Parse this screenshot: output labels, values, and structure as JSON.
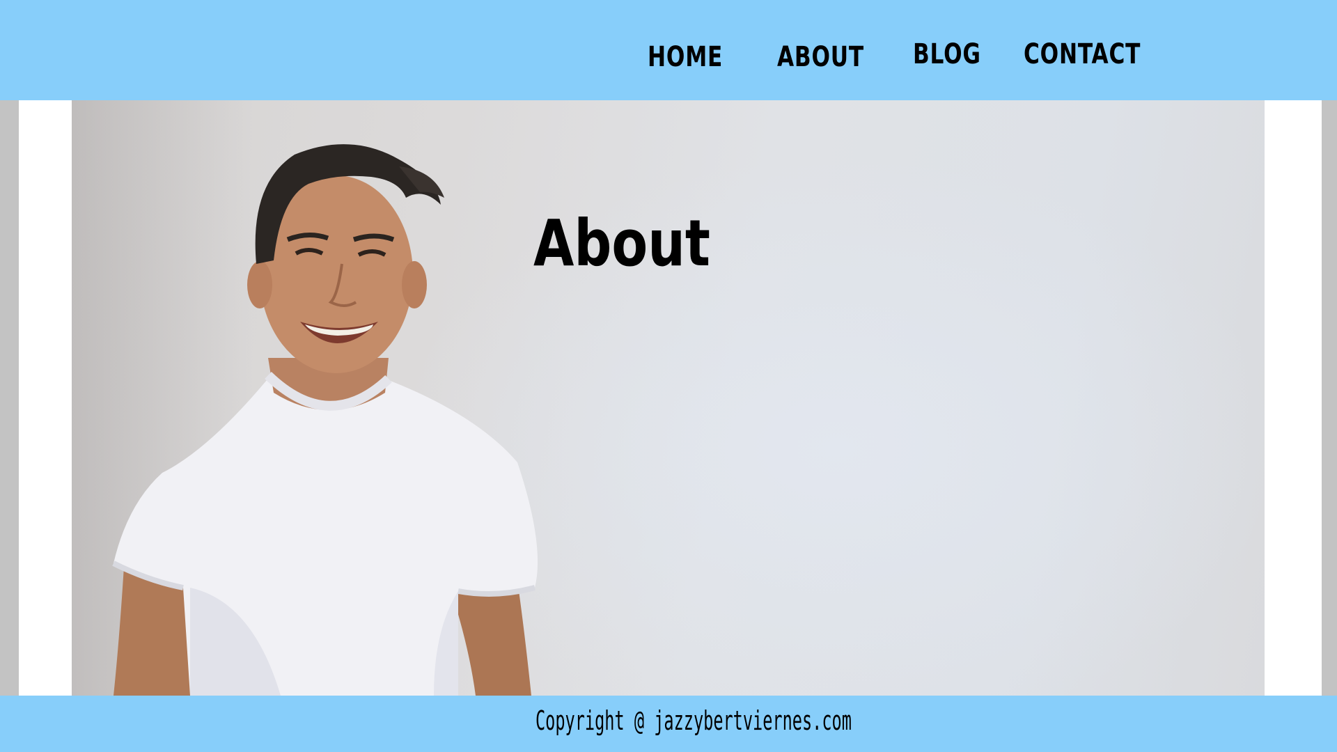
{
  "nav": {
    "items": [
      {
        "label": "HOME"
      },
      {
        "label": "ABOUT"
      },
      {
        "label": "BLOG"
      },
      {
        "label": "CONTACT"
      }
    ]
  },
  "hero": {
    "title": "About",
    "image": "portrait-photo-smiling-man-white-tshirt"
  },
  "footer": {
    "copyright": "Copyright @ jazzybertviernes.com"
  },
  "colors": {
    "header_bg": "#87cefa",
    "footer_bg": "#87cefa",
    "gutter_gray": "#c3c3c3",
    "gutter_white": "#ffffff",
    "text": "#000000"
  }
}
